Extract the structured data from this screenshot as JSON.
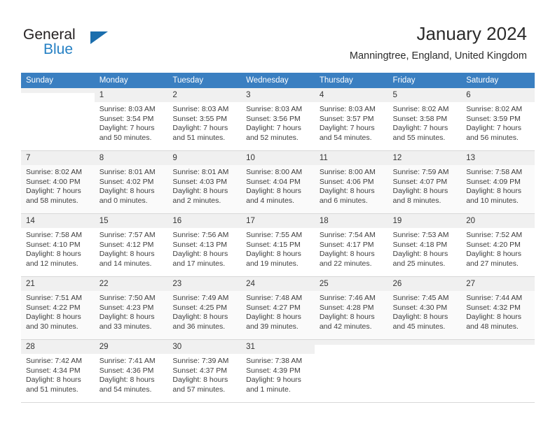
{
  "brand": {
    "name_part1": "General",
    "name_part2": "Blue",
    "accent_color": "#2580c4",
    "triangle_color": "#1b6ead",
    "logo_icon": "triangle-icon"
  },
  "header": {
    "month_title": "January 2024",
    "location": "Manningtree, England, United Kingdom"
  },
  "calendar": {
    "header_bg": "#3a7fc1",
    "weekdays": [
      "Sunday",
      "Monday",
      "Tuesday",
      "Wednesday",
      "Thursday",
      "Friday",
      "Saturday"
    ],
    "weeks": [
      [
        {
          "day": "",
          "sunrise": "",
          "sunset": "",
          "daylight_line1": "",
          "daylight_line2": ""
        },
        {
          "day": "1",
          "sunrise": "Sunrise: 8:03 AM",
          "sunset": "Sunset: 3:54 PM",
          "daylight_line1": "Daylight: 7 hours",
          "daylight_line2": "and 50 minutes."
        },
        {
          "day": "2",
          "sunrise": "Sunrise: 8:03 AM",
          "sunset": "Sunset: 3:55 PM",
          "daylight_line1": "Daylight: 7 hours",
          "daylight_line2": "and 51 minutes."
        },
        {
          "day": "3",
          "sunrise": "Sunrise: 8:03 AM",
          "sunset": "Sunset: 3:56 PM",
          "daylight_line1": "Daylight: 7 hours",
          "daylight_line2": "and 52 minutes."
        },
        {
          "day": "4",
          "sunrise": "Sunrise: 8:03 AM",
          "sunset": "Sunset: 3:57 PM",
          "daylight_line1": "Daylight: 7 hours",
          "daylight_line2": "and 54 minutes."
        },
        {
          "day": "5",
          "sunrise": "Sunrise: 8:02 AM",
          "sunset": "Sunset: 3:58 PM",
          "daylight_line1": "Daylight: 7 hours",
          "daylight_line2": "and 55 minutes."
        },
        {
          "day": "6",
          "sunrise": "Sunrise: 8:02 AM",
          "sunset": "Sunset: 3:59 PM",
          "daylight_line1": "Daylight: 7 hours",
          "daylight_line2": "and 56 minutes."
        }
      ],
      [
        {
          "day": "7",
          "sunrise": "Sunrise: 8:02 AM",
          "sunset": "Sunset: 4:00 PM",
          "daylight_line1": "Daylight: 7 hours",
          "daylight_line2": "and 58 minutes."
        },
        {
          "day": "8",
          "sunrise": "Sunrise: 8:01 AM",
          "sunset": "Sunset: 4:02 PM",
          "daylight_line1": "Daylight: 8 hours",
          "daylight_line2": "and 0 minutes."
        },
        {
          "day": "9",
          "sunrise": "Sunrise: 8:01 AM",
          "sunset": "Sunset: 4:03 PM",
          "daylight_line1": "Daylight: 8 hours",
          "daylight_line2": "and 2 minutes."
        },
        {
          "day": "10",
          "sunrise": "Sunrise: 8:00 AM",
          "sunset": "Sunset: 4:04 PM",
          "daylight_line1": "Daylight: 8 hours",
          "daylight_line2": "and 4 minutes."
        },
        {
          "day": "11",
          "sunrise": "Sunrise: 8:00 AM",
          "sunset": "Sunset: 4:06 PM",
          "daylight_line1": "Daylight: 8 hours",
          "daylight_line2": "and 6 minutes."
        },
        {
          "day": "12",
          "sunrise": "Sunrise: 7:59 AM",
          "sunset": "Sunset: 4:07 PM",
          "daylight_line1": "Daylight: 8 hours",
          "daylight_line2": "and 8 minutes."
        },
        {
          "day": "13",
          "sunrise": "Sunrise: 7:58 AM",
          "sunset": "Sunset: 4:09 PM",
          "daylight_line1": "Daylight: 8 hours",
          "daylight_line2": "and 10 minutes."
        }
      ],
      [
        {
          "day": "14",
          "sunrise": "Sunrise: 7:58 AM",
          "sunset": "Sunset: 4:10 PM",
          "daylight_line1": "Daylight: 8 hours",
          "daylight_line2": "and 12 minutes."
        },
        {
          "day": "15",
          "sunrise": "Sunrise: 7:57 AM",
          "sunset": "Sunset: 4:12 PM",
          "daylight_line1": "Daylight: 8 hours",
          "daylight_line2": "and 14 minutes."
        },
        {
          "day": "16",
          "sunrise": "Sunrise: 7:56 AM",
          "sunset": "Sunset: 4:13 PM",
          "daylight_line1": "Daylight: 8 hours",
          "daylight_line2": "and 17 minutes."
        },
        {
          "day": "17",
          "sunrise": "Sunrise: 7:55 AM",
          "sunset": "Sunset: 4:15 PM",
          "daylight_line1": "Daylight: 8 hours",
          "daylight_line2": "and 19 minutes."
        },
        {
          "day": "18",
          "sunrise": "Sunrise: 7:54 AM",
          "sunset": "Sunset: 4:17 PM",
          "daylight_line1": "Daylight: 8 hours",
          "daylight_line2": "and 22 minutes."
        },
        {
          "day": "19",
          "sunrise": "Sunrise: 7:53 AM",
          "sunset": "Sunset: 4:18 PM",
          "daylight_line1": "Daylight: 8 hours",
          "daylight_line2": "and 25 minutes."
        },
        {
          "day": "20",
          "sunrise": "Sunrise: 7:52 AM",
          "sunset": "Sunset: 4:20 PM",
          "daylight_line1": "Daylight: 8 hours",
          "daylight_line2": "and 27 minutes."
        }
      ],
      [
        {
          "day": "21",
          "sunrise": "Sunrise: 7:51 AM",
          "sunset": "Sunset: 4:22 PM",
          "daylight_line1": "Daylight: 8 hours",
          "daylight_line2": "and 30 minutes."
        },
        {
          "day": "22",
          "sunrise": "Sunrise: 7:50 AM",
          "sunset": "Sunset: 4:23 PM",
          "daylight_line1": "Daylight: 8 hours",
          "daylight_line2": "and 33 minutes."
        },
        {
          "day": "23",
          "sunrise": "Sunrise: 7:49 AM",
          "sunset": "Sunset: 4:25 PM",
          "daylight_line1": "Daylight: 8 hours",
          "daylight_line2": "and 36 minutes."
        },
        {
          "day": "24",
          "sunrise": "Sunrise: 7:48 AM",
          "sunset": "Sunset: 4:27 PM",
          "daylight_line1": "Daylight: 8 hours",
          "daylight_line2": "and 39 minutes."
        },
        {
          "day": "25",
          "sunrise": "Sunrise: 7:46 AM",
          "sunset": "Sunset: 4:28 PM",
          "daylight_line1": "Daylight: 8 hours",
          "daylight_line2": "and 42 minutes."
        },
        {
          "day": "26",
          "sunrise": "Sunrise: 7:45 AM",
          "sunset": "Sunset: 4:30 PM",
          "daylight_line1": "Daylight: 8 hours",
          "daylight_line2": "and 45 minutes."
        },
        {
          "day": "27",
          "sunrise": "Sunrise: 7:44 AM",
          "sunset": "Sunset: 4:32 PM",
          "daylight_line1": "Daylight: 8 hours",
          "daylight_line2": "and 48 minutes."
        }
      ],
      [
        {
          "day": "28",
          "sunrise": "Sunrise: 7:42 AM",
          "sunset": "Sunset: 4:34 PM",
          "daylight_line1": "Daylight: 8 hours",
          "daylight_line2": "and 51 minutes."
        },
        {
          "day": "29",
          "sunrise": "Sunrise: 7:41 AM",
          "sunset": "Sunset: 4:36 PM",
          "daylight_line1": "Daylight: 8 hours",
          "daylight_line2": "and 54 minutes."
        },
        {
          "day": "30",
          "sunrise": "Sunrise: 7:39 AM",
          "sunset": "Sunset: 4:37 PM",
          "daylight_line1": "Daylight: 8 hours",
          "daylight_line2": "and 57 minutes."
        },
        {
          "day": "31",
          "sunrise": "Sunrise: 7:38 AM",
          "sunset": "Sunset: 4:39 PM",
          "daylight_line1": "Daylight: 9 hours",
          "daylight_line2": "and 1 minute."
        },
        {
          "day": "",
          "sunrise": "",
          "sunset": "",
          "daylight_line1": "",
          "daylight_line2": ""
        },
        {
          "day": "",
          "sunrise": "",
          "sunset": "",
          "daylight_line1": "",
          "daylight_line2": ""
        },
        {
          "day": "",
          "sunrise": "",
          "sunset": "",
          "daylight_line1": "",
          "daylight_line2": ""
        }
      ]
    ]
  }
}
